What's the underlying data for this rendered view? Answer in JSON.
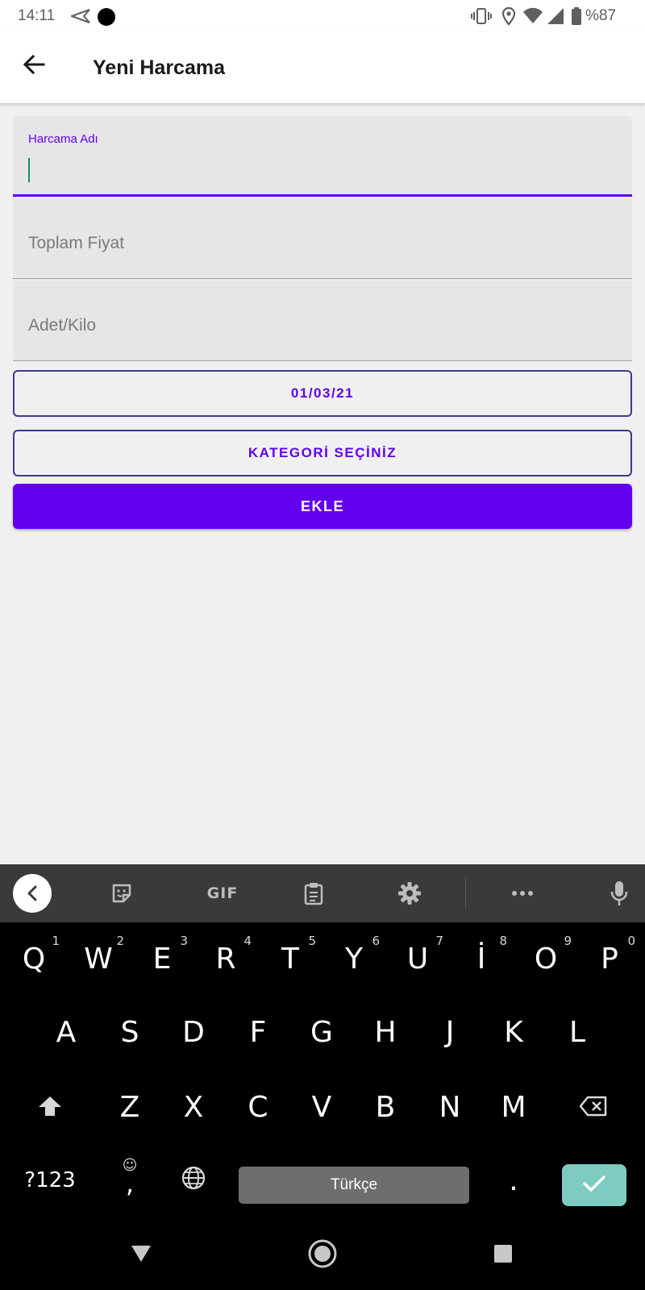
{
  "status_bar": {
    "time": "14:11",
    "battery": "%87",
    "icons": [
      "send-icon",
      "dot-icon",
      "vibrate-icon",
      "location-icon",
      "wifi-icon",
      "signal-icon",
      "battery-icon"
    ]
  },
  "app_bar": {
    "title": "Yeni Harcama",
    "back_icon": "arrow-left-icon"
  },
  "form": {
    "name_label": "Harcama Adı",
    "name_value": "",
    "price_placeholder": "Toplam Fiyat",
    "qty_placeholder": "Adet/Kilo",
    "date_button": "01/03/21",
    "category_button": "KATEGORİ SEÇİNİZ",
    "submit_button": "EKLE"
  },
  "colors": {
    "accent": "#6200ee",
    "cursor": "#1b8a72",
    "enter_key": "#7ecbc1"
  },
  "keyboard": {
    "toolbar": {
      "collapse_icon": "chevron-left-icon",
      "sticker_icon": "sticker-icon",
      "gif_label": "GIF",
      "clipboard_icon": "clipboard-icon",
      "settings_icon": "gear-icon",
      "more_icon": "more-horizontal-icon",
      "mic_icon": "microphone-icon"
    },
    "row1": [
      "Q",
      "W",
      "E",
      "R",
      "T",
      "Y",
      "U",
      "İ",
      "O",
      "P"
    ],
    "row1_hints": [
      "1",
      "2",
      "3",
      "4",
      "5",
      "6",
      "7",
      "8",
      "9",
      "0"
    ],
    "row2": [
      "A",
      "S",
      "D",
      "F",
      "G",
      "H",
      "J",
      "K",
      "L"
    ],
    "row3": [
      "Z",
      "X",
      "C",
      "V",
      "B",
      "N",
      "M"
    ],
    "sym_key": "?123",
    "comma_key": ",",
    "emoji_hint": "☺",
    "space_label": "Türkçe",
    "period_key": "."
  },
  "nav": {
    "back_icon": "triangle-back-icon",
    "home_icon": "circle-home-icon",
    "recents_icon": "square-recents-icon"
  }
}
